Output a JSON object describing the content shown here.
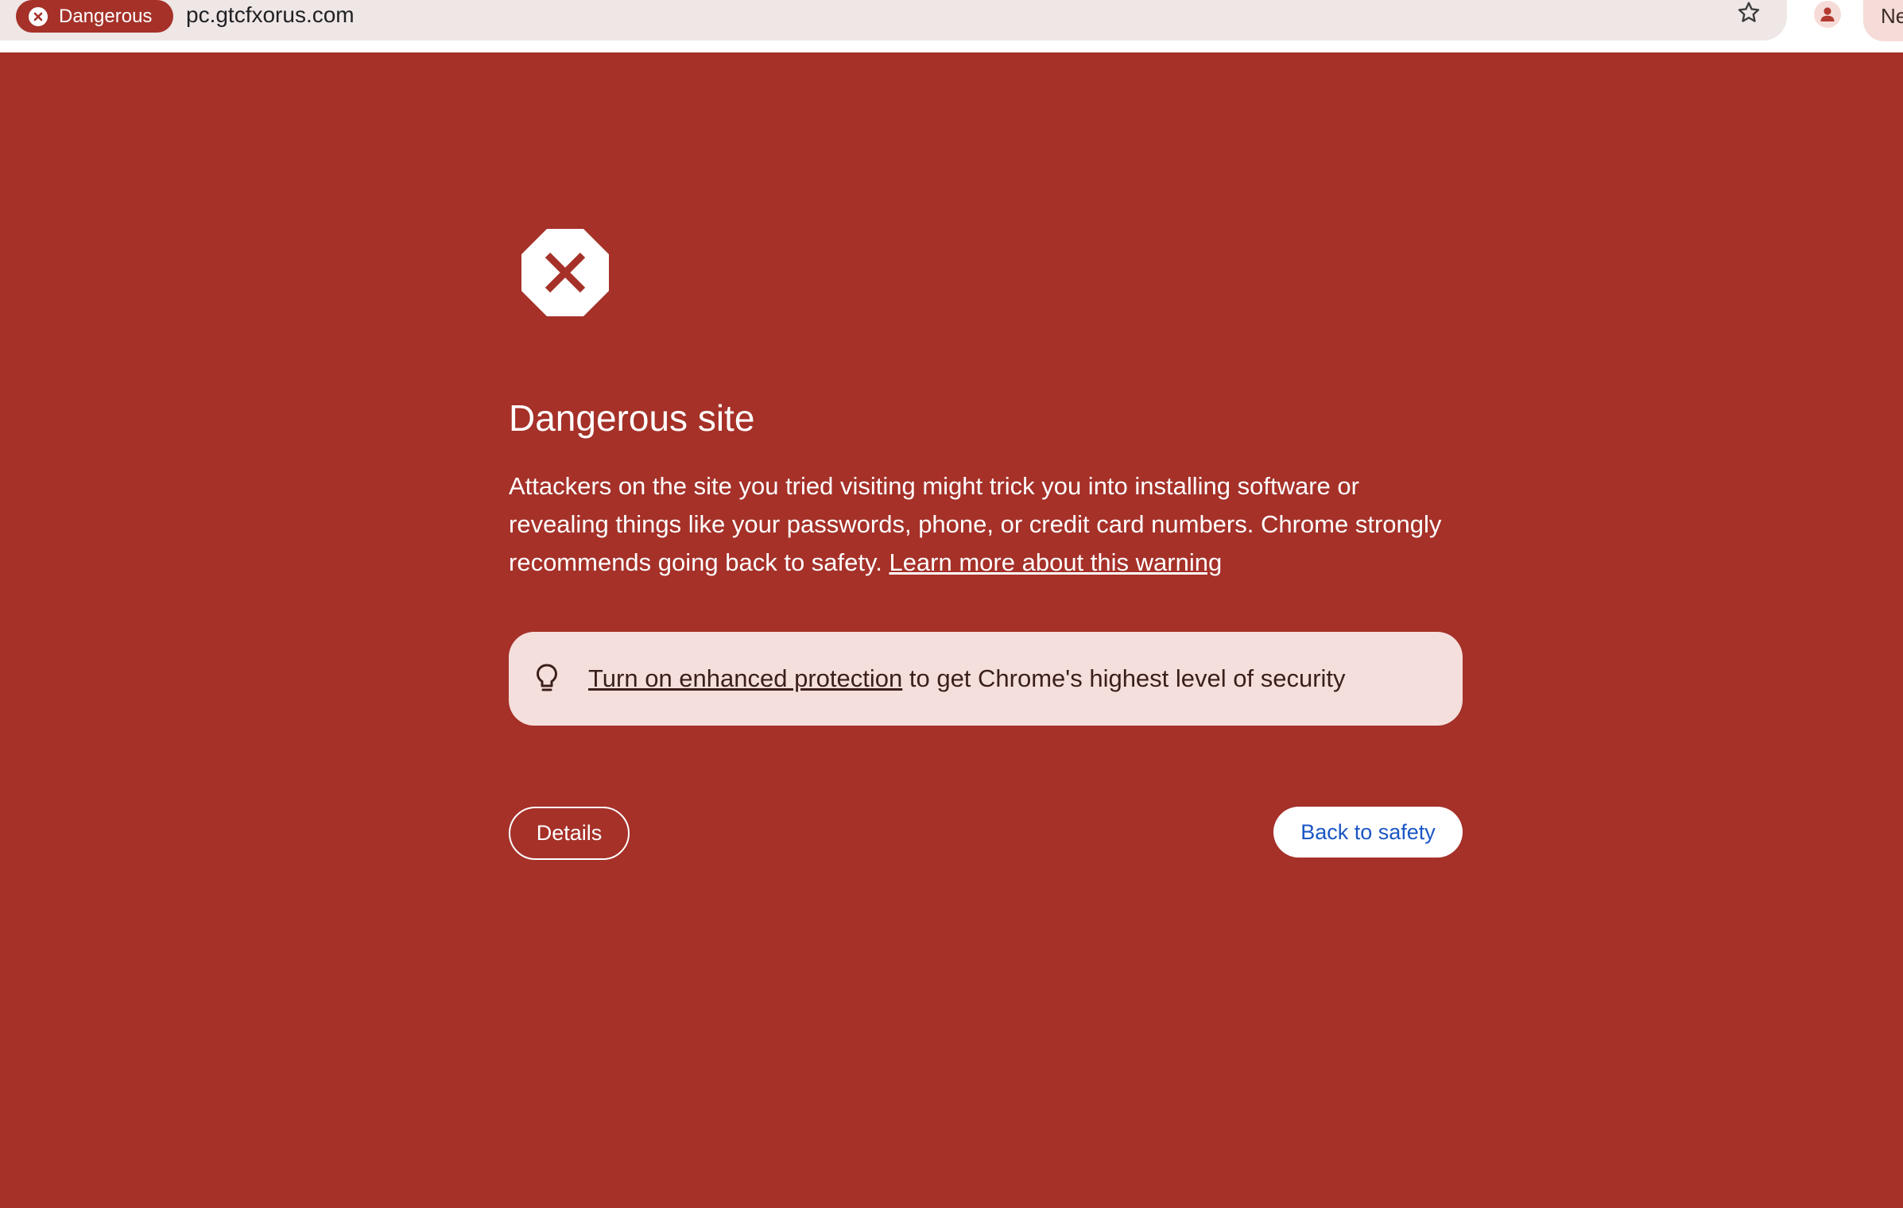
{
  "browser": {
    "security_chip_label": "Dangerous",
    "url": "pc.gtcfxorus.com",
    "side_button_label": "Ne"
  },
  "interstitial": {
    "heading": "Dangerous site",
    "body_text": "Attackers on the site you tried visiting might trick you into installing software or revealing things like your passwords, phone, or credit card numbers. Chrome strongly recommends going back to safety. ",
    "learn_more_link": "Learn more about this warning",
    "tip_link": "Turn on enhanced protection",
    "tip_text": " to get Chrome's highest level of security",
    "details_button": "Details",
    "back_button": "Back to safety"
  },
  "icons": {
    "chip": "close-circle-icon",
    "star": "star-outline-icon",
    "profile": "person-icon",
    "warning": "octagon-x-icon",
    "tip": "lightbulb-icon"
  },
  "colors": {
    "danger_background": "#a53129",
    "omnibox_background": "#efe6e6",
    "tip_background": "#f5dfdc",
    "link_blue": "#1a56c4",
    "white": "#ffffff"
  }
}
